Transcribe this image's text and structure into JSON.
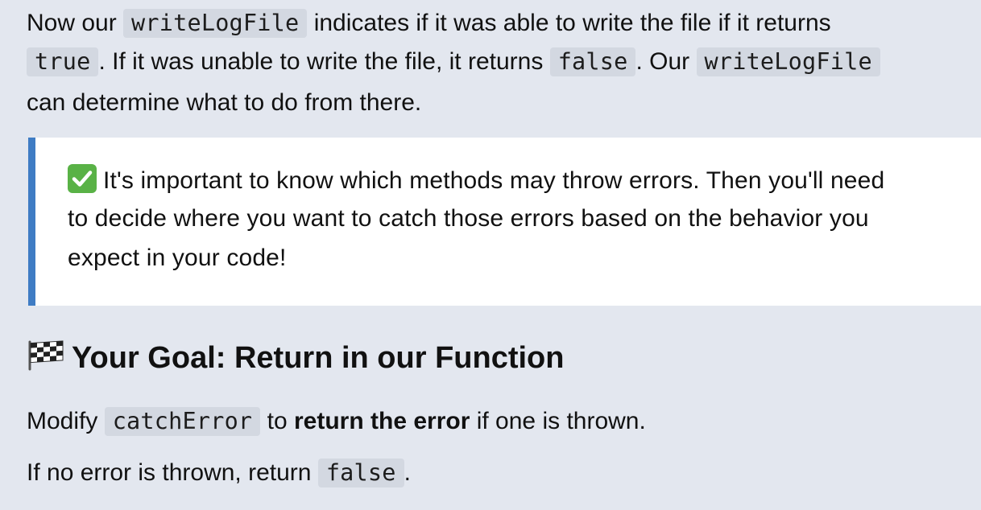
{
  "intro": {
    "line1": {
      "t1": "Now our ",
      "code1": "writeLogFile",
      "t2": " indicates if it was able to write the file if it returns"
    },
    "line2": {
      "code1": "true",
      "t1": ". If it was unable to write the file, it returns ",
      "code2": "false",
      "t2": ". Our ",
      "code3": "writeLogFile"
    },
    "line3": "can determine what to do from there."
  },
  "callout": {
    "icon": "check-mark-icon",
    "accent_color": "#3f7cc4",
    "line1": "It's important to know which methods may throw errors. Then you'll need",
    "line2": "to decide where you want to catch those errors based on the behavior you",
    "line3": "expect in your code!"
  },
  "goal": {
    "icon": "checkered-flag-icon",
    "heading": "Your Goal: Return in our Function",
    "line1": {
      "t1": "Modify ",
      "code1": "catchError",
      "t2": " to ",
      "bold": "return the error",
      "t3": " if one is thrown."
    },
    "line2": {
      "t1": "If no error is thrown, return ",
      "code1": "false",
      "t2": "."
    }
  }
}
